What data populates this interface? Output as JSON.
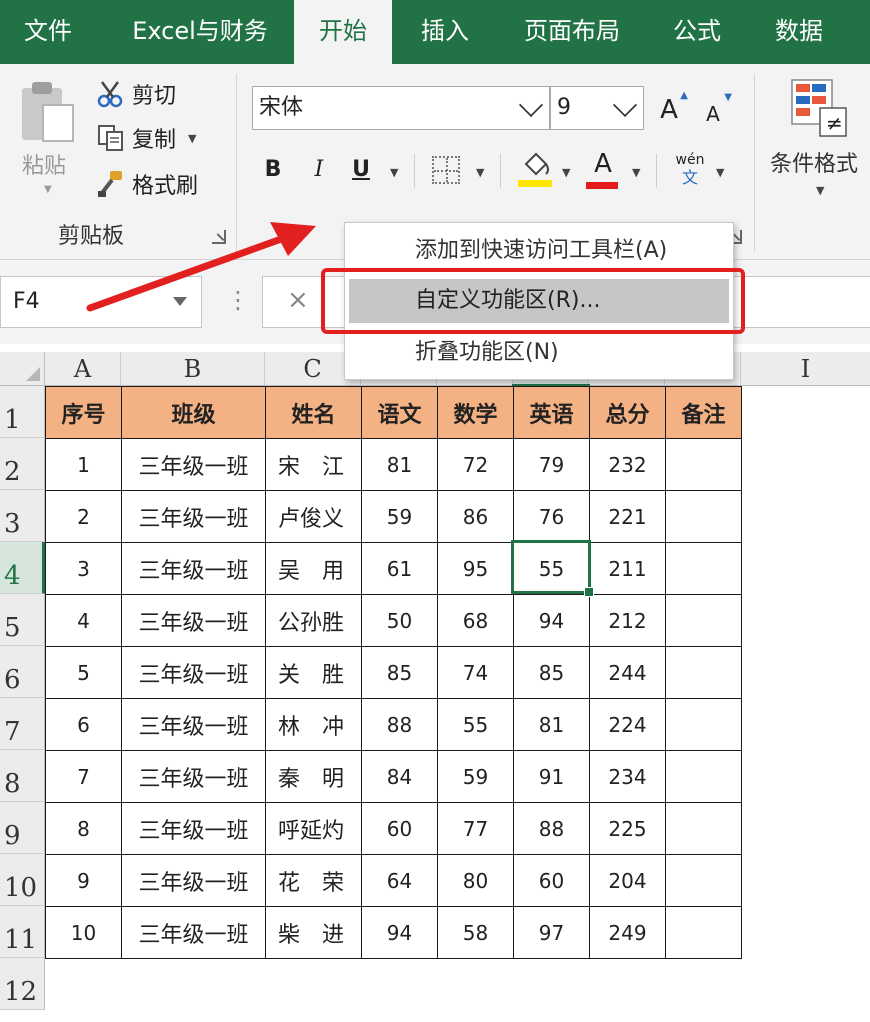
{
  "tabs": [
    {
      "label": "文件",
      "active": false
    },
    {
      "label": "Excel与财务",
      "active": false
    },
    {
      "label": "开始",
      "active": true
    },
    {
      "label": "插入",
      "active": false
    },
    {
      "label": "页面布局",
      "active": false
    },
    {
      "label": "公式",
      "active": false
    },
    {
      "label": "数据",
      "active": false
    }
  ],
  "clipboard": {
    "paste_label": "粘贴",
    "cut_label": "剪切",
    "copy_label": "复制",
    "format_painter_label": "格式刷",
    "group_label": "剪贴板"
  },
  "font": {
    "name": "宋体",
    "size": "9",
    "grow_label": "A",
    "shrink_label": "A",
    "bold": "B",
    "italic": "I",
    "underline": "U",
    "font_color_label": "A",
    "phonetic_top": "wén",
    "phonetic_bottom": "文"
  },
  "styles": {
    "conditional_format_label": "条件格式"
  },
  "context_menu": {
    "items": [
      {
        "label": "添加到快速访问工具栏(A)",
        "highlighted": false
      },
      {
        "label": "自定义功能区(R)...",
        "highlighted": true
      },
      {
        "label": "折叠功能区(N)",
        "highlighted": false
      }
    ]
  },
  "name_box": {
    "value": "F4"
  },
  "formula_bar": {
    "cancel_symbol": "×"
  },
  "columns": [
    "A",
    "B",
    "C",
    "",
    "",
    "",
    "",
    "",
    "I"
  ],
  "rows": [
    "1",
    "2",
    "3",
    "4",
    "5",
    "6",
    "7",
    "8",
    "9",
    "10",
    "11",
    "12"
  ],
  "selected_row": "4",
  "table": {
    "headers": [
      "序号",
      "班级",
      "姓名",
      "语文",
      "数学",
      "英语",
      "总分",
      "备注"
    ],
    "rows": [
      [
        "1",
        "三年级一班",
        "宋　江",
        "81",
        "72",
        "79",
        "232",
        ""
      ],
      [
        "2",
        "三年级一班",
        "卢俊义",
        "59",
        "86",
        "76",
        "221",
        ""
      ],
      [
        "3",
        "三年级一班",
        "吴　用",
        "61",
        "95",
        "55",
        "211",
        ""
      ],
      [
        "4",
        "三年级一班",
        "公孙胜",
        "50",
        "68",
        "94",
        "212",
        ""
      ],
      [
        "5",
        "三年级一班",
        "关　胜",
        "85",
        "74",
        "85",
        "244",
        ""
      ],
      [
        "6",
        "三年级一班",
        "林　冲",
        "88",
        "55",
        "81",
        "224",
        ""
      ],
      [
        "7",
        "三年级一班",
        "秦　明",
        "84",
        "59",
        "91",
        "234",
        ""
      ],
      [
        "8",
        "三年级一班",
        "呼延灼",
        "60",
        "77",
        "88",
        "225",
        ""
      ],
      [
        "9",
        "三年级一班",
        "花　荣",
        "64",
        "80",
        "60",
        "204",
        ""
      ],
      [
        "10",
        "三年级一班",
        "柴　进",
        "94",
        "58",
        "97",
        "249",
        ""
      ]
    ]
  },
  "colors": {
    "excel_green": "#217346",
    "header_fill": "#f4b183",
    "highlight_box": "#e32020",
    "font_color_bar": "#e31b1b",
    "fill_color_bar": "#ffe600"
  }
}
